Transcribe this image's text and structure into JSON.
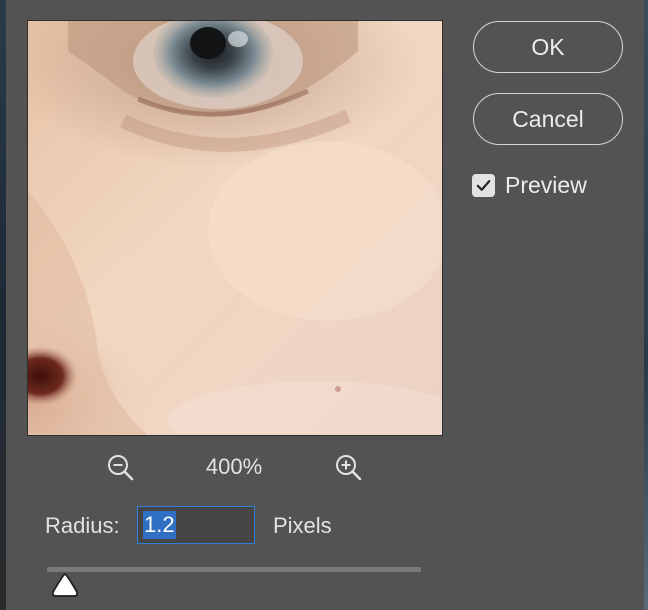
{
  "dialog": {
    "buttons": {
      "ok_label": "OK",
      "cancel_label": "Cancel"
    },
    "preview_checkbox": {
      "label": "Preview",
      "checked": true
    },
    "zoom": {
      "level": "400%",
      "zoom_out_icon": "zoom-out-magnifier-icon",
      "zoom_in_icon": "zoom-in-magnifier-icon"
    },
    "radius": {
      "label": "Radius:",
      "value": "1.2",
      "units": "Pixels",
      "slider_fraction": 0.02
    },
    "colors": {
      "panel_bg": "#535353",
      "accent_focus": "#2f7fd6",
      "text": "#e3e3e3"
    }
  }
}
